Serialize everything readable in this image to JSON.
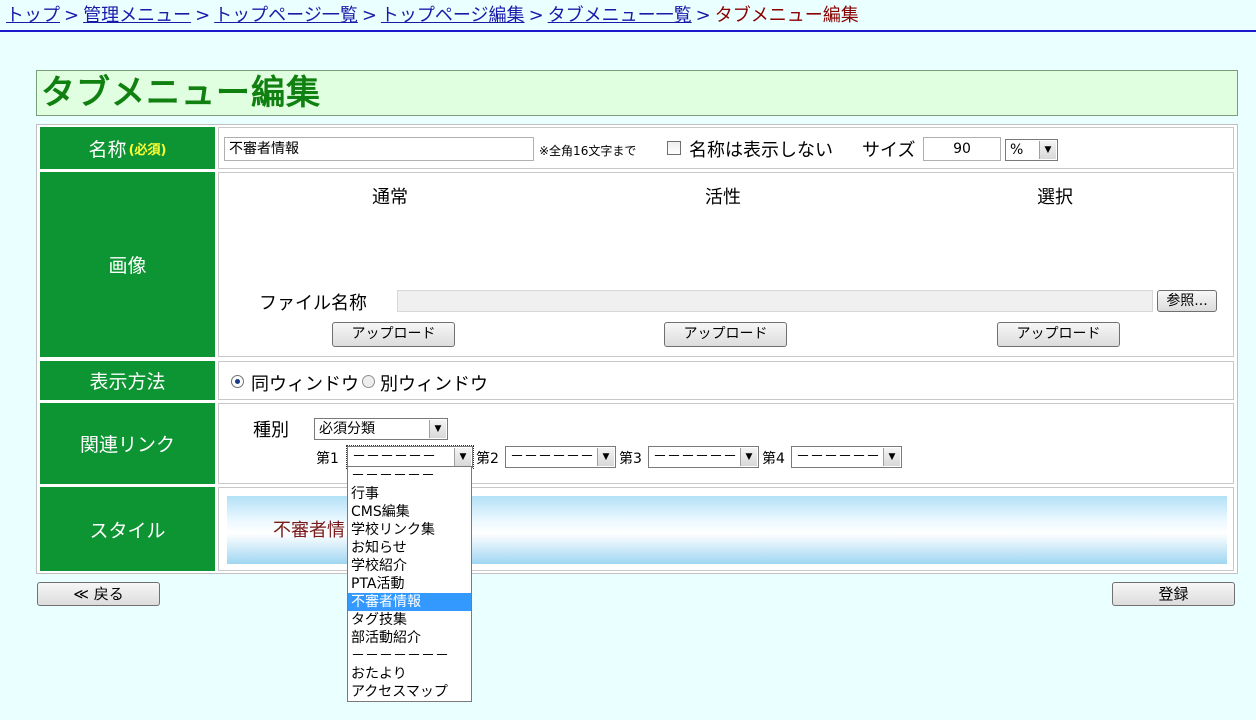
{
  "breadcrumb": {
    "items": [
      "トップ",
      "管理メニュー",
      "トップページ一覧",
      "トップページ編集",
      "タブメニュー一覧"
    ],
    "separator": ">",
    "current": "タブメニュー編集"
  },
  "page_title": "タブメニュー編集",
  "name_row": {
    "label": "名称",
    "required": "(必須)",
    "value": "不審者情報",
    "hint": "※全角16文字まで",
    "hide_checkbox_label": "名称は表示しない",
    "size_label": "サイズ",
    "size_value": "90",
    "unit_value": "%"
  },
  "image_row": {
    "label": "画像",
    "col_normal": "通常",
    "col_active": "活性",
    "col_selected": "選択",
    "file_name_label": "ファイル名称",
    "browse_button": "参照...",
    "upload_button": "アップロード"
  },
  "display_row": {
    "label": "表示方法",
    "option_same": "同ウィンドウ",
    "option_other": "別ウィンドウ"
  },
  "link_row": {
    "label": "関連リンク",
    "type_label": "種別",
    "type_value": "必須分類",
    "slot1_label": "第1",
    "slot2_label": "第2",
    "slot3_label": "第3",
    "slot4_label": "第4",
    "slot_value": "－－－－－－"
  },
  "style_row": {
    "label": "スタイル",
    "preview_text": "不審者情"
  },
  "dropdown_options": [
    "－－－－－－",
    "行事",
    "CMS編集",
    "学校リンク集",
    "お知らせ",
    "学校紹介",
    "PTA活動",
    "不審者情報",
    "タグ技集",
    "部活動紹介",
    "－－－－－－－",
    "おたより",
    "アクセスマップ"
  ],
  "dropdown_selected_index": 7,
  "footer": {
    "back_button": "≪ 戻る",
    "register_button": "登録"
  },
  "colors": {
    "label_bg": "#0d9433",
    "title_color": "#108010",
    "title_bg": "#e0ffe0",
    "page_bg": "#eaffff",
    "selected_option_bg": "#3399ff"
  }
}
